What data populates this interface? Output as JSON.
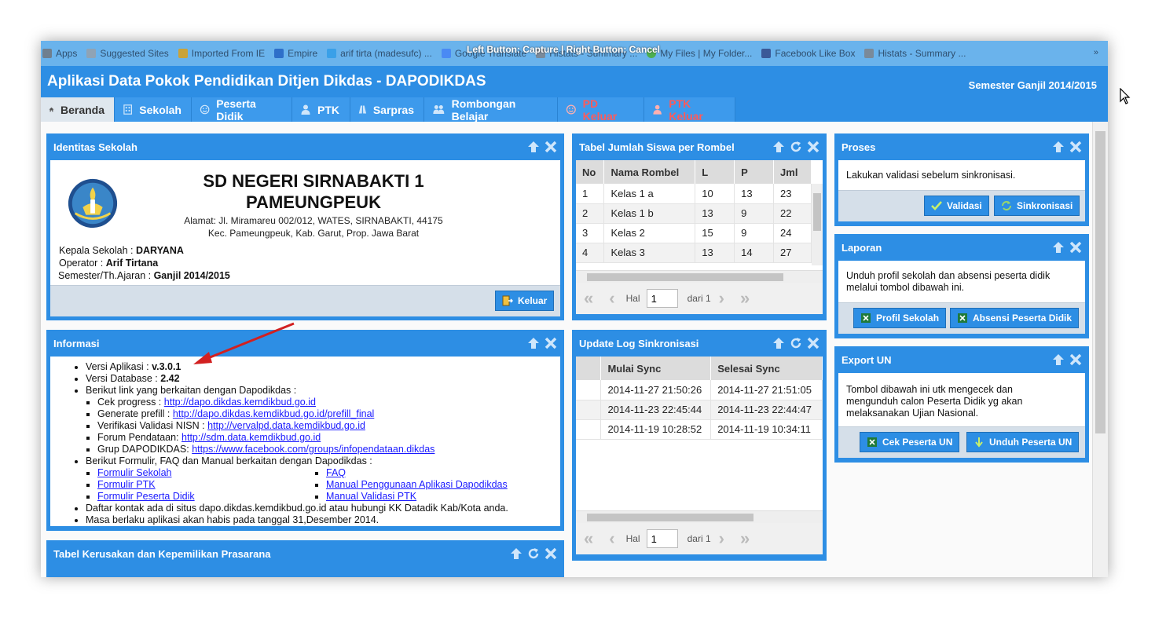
{
  "bookmarks": [
    {
      "label": "Apps",
      "color": "#6f7f8f"
    },
    {
      "label": "Suggested Sites",
      "color": "#8fa3b5"
    },
    {
      "label": "Imported From IE",
      "color": "#c9a33a"
    },
    {
      "label": "Empire",
      "color": "#2e6fc9"
    },
    {
      "label": "arif tirta (madesufc) ...",
      "color": "#3aa0e8"
    },
    {
      "label": "Google Translate",
      "color": "#4a8af4"
    },
    {
      "label": "Histats - Summary ...",
      "color": "#7a8a9a"
    },
    {
      "label": "My Files | My Folder...",
      "color": "#4caf50"
    },
    {
      "label": "Facebook Like Box",
      "color": "#3b5998"
    },
    {
      "label": "Histats - Summary ...",
      "color": "#7a8a9a"
    }
  ],
  "bookmarks_more": "»",
  "capture_tip": "Left Button: Capture | Right Button: Cancel",
  "header": {
    "title": "Aplikasi Data Pokok Pendidikan Ditjen Dikdas - DAPODIKDAS",
    "semester": "Semester Ganjil 2014/2015"
  },
  "nav": [
    {
      "label": "Beranda",
      "icon": "home-icon"
    },
    {
      "label": "Sekolah",
      "icon": "building-icon"
    },
    {
      "label": "Peserta Didik",
      "icon": "smile-icon"
    },
    {
      "label": "PTK",
      "icon": "user-icon"
    },
    {
      "label": "Sarpras",
      "icon": "road-icon"
    },
    {
      "label": "Rombongan Belajar",
      "icon": "group-icon"
    },
    {
      "label": "PD Keluar",
      "icon": "smile-icon"
    },
    {
      "label": "PTK Keluar",
      "icon": "user-icon"
    }
  ],
  "identitas": {
    "title": "Identitas Sekolah",
    "school_line1": "SD NEGERI SIRNABAKTI 1",
    "school_line2": "PAMEUNGPEUK",
    "address": "Alamat: Jl. Miramareu 002/012, WATES, SIRNABAKTI, 44175",
    "district": "Kec. Pameungpeuk, Kab. Garut, Prop. Jawa Barat",
    "kepala_label": "Kepala Sekolah : ",
    "kepala_value": "DARYANA",
    "operator_label": "Operator : ",
    "operator_value": "Arif Tirtana",
    "semester_label": "Semester/Th.Ajaran : ",
    "semester_value": "Ganjil 2014/2015",
    "keluar_button": "Keluar"
  },
  "informasi": {
    "title": "Informasi",
    "versi_aplikasi_label": "Versi Aplikasi : ",
    "versi_aplikasi": "v.3.0.1",
    "versi_database_label": "Versi Database : ",
    "versi_database": "2.42",
    "links_heading": "Berikut link yang berkaitan dengan Dapodikdas :",
    "links": [
      {
        "label": "Cek progress : ",
        "url": "http://dapo.dikdas.kemdikbud.go.id"
      },
      {
        "label": "Generate prefill : ",
        "url": "http://dapo.dikdas.kemdikbud.go.id/prefill_final"
      },
      {
        "label": "Verifikasi Validasi NISN : ",
        "url": "http://vervalpd.data.kemdikbud.go.id"
      },
      {
        "label": "Forum Pendataan: ",
        "url": "http://sdm.data.kemdikbud.go.id"
      },
      {
        "label": "Grup DAPODIKDAS: ",
        "url": "https://www.facebook.com/groups/infopendataan.dikdas"
      }
    ],
    "forms_heading": "Berikut Formulir, FAQ dan Manual berkaitan dengan Dapodikdas :",
    "forms_left": [
      "Formulir Sekolah",
      "Formulir PTK",
      "Formulir Peserta Didik"
    ],
    "forms_right": [
      "FAQ",
      "Manual Penggunaan Aplikasi Dapodikdas",
      "Manual Validasi PTK"
    ],
    "contact": "Daftar kontak ada di situs dapo.dikdas.kemdikbud.go.id atau hubungi KK Datadik Kab/Kota anda.",
    "expiry": "Masa berlaku aplikasi akan habis pada tanggal 31,Desember 2014."
  },
  "kerusakan": {
    "title": "Tabel Kerusakan dan Kepemilikan Prasarana"
  },
  "rombel": {
    "title": "Tabel Jumlah Siswa per Rombel",
    "columns": [
      "No",
      "Nama Rombel",
      "L",
      "P",
      "Jml"
    ],
    "rows": [
      [
        "1",
        "Kelas 1 a",
        "10",
        "13",
        "23"
      ],
      [
        "2",
        "Kelas 1 b",
        "13",
        "9",
        "22"
      ],
      [
        "3",
        "Kelas 2",
        "15",
        "9",
        "24"
      ],
      [
        "4",
        "Kelas 3",
        "13",
        "14",
        "27"
      ]
    ],
    "pager": {
      "hal": "Hal",
      "page": "1",
      "dari": "dari 1"
    }
  },
  "sync_log": {
    "title": "Update Log Sinkronisasi",
    "columns": [
      "Mulai Sync",
      "Selesai Sync"
    ],
    "rows": [
      [
        "2014-11-27 21:50:26",
        "2014-11-27 21:51:05"
      ],
      [
        "2014-11-23 22:45:44",
        "2014-11-23 22:44:47"
      ],
      [
        "2014-11-19 10:28:52",
        "2014-11-19 10:34:11"
      ]
    ],
    "pager": {
      "hal": "Hal",
      "page": "1",
      "dari": "dari 1"
    }
  },
  "proses": {
    "title": "Proses",
    "text": "Lakukan validasi sebelum sinkronisasi.",
    "validasi_button": "Validasi",
    "sinkronisasi_button": "Sinkronisasi"
  },
  "laporan": {
    "title": "Laporan",
    "text_line1": "Unduh profil sekolah dan absensi peserta didik",
    "text_line2": "melalui tombol dibawah ini.",
    "profil_button": "Profil Sekolah",
    "absensi_button": "Absensi Peserta Didik"
  },
  "export_un": {
    "title": "Export UN",
    "text_line1": "Tombol dibawah ini utk mengecek dan",
    "text_line2": "mengunduh calon Peserta Didik yg akan",
    "text_line3": "melaksanakan Ujian Nasional.",
    "cek_button": "Cek Peserta UN",
    "unduh_button": "Unduh Peserta UN"
  },
  "colors": {
    "primary": "#2d8ee4",
    "danger": "#ff5a5a",
    "link": "#1a1aff",
    "annotation_arrow": "#d22020"
  }
}
